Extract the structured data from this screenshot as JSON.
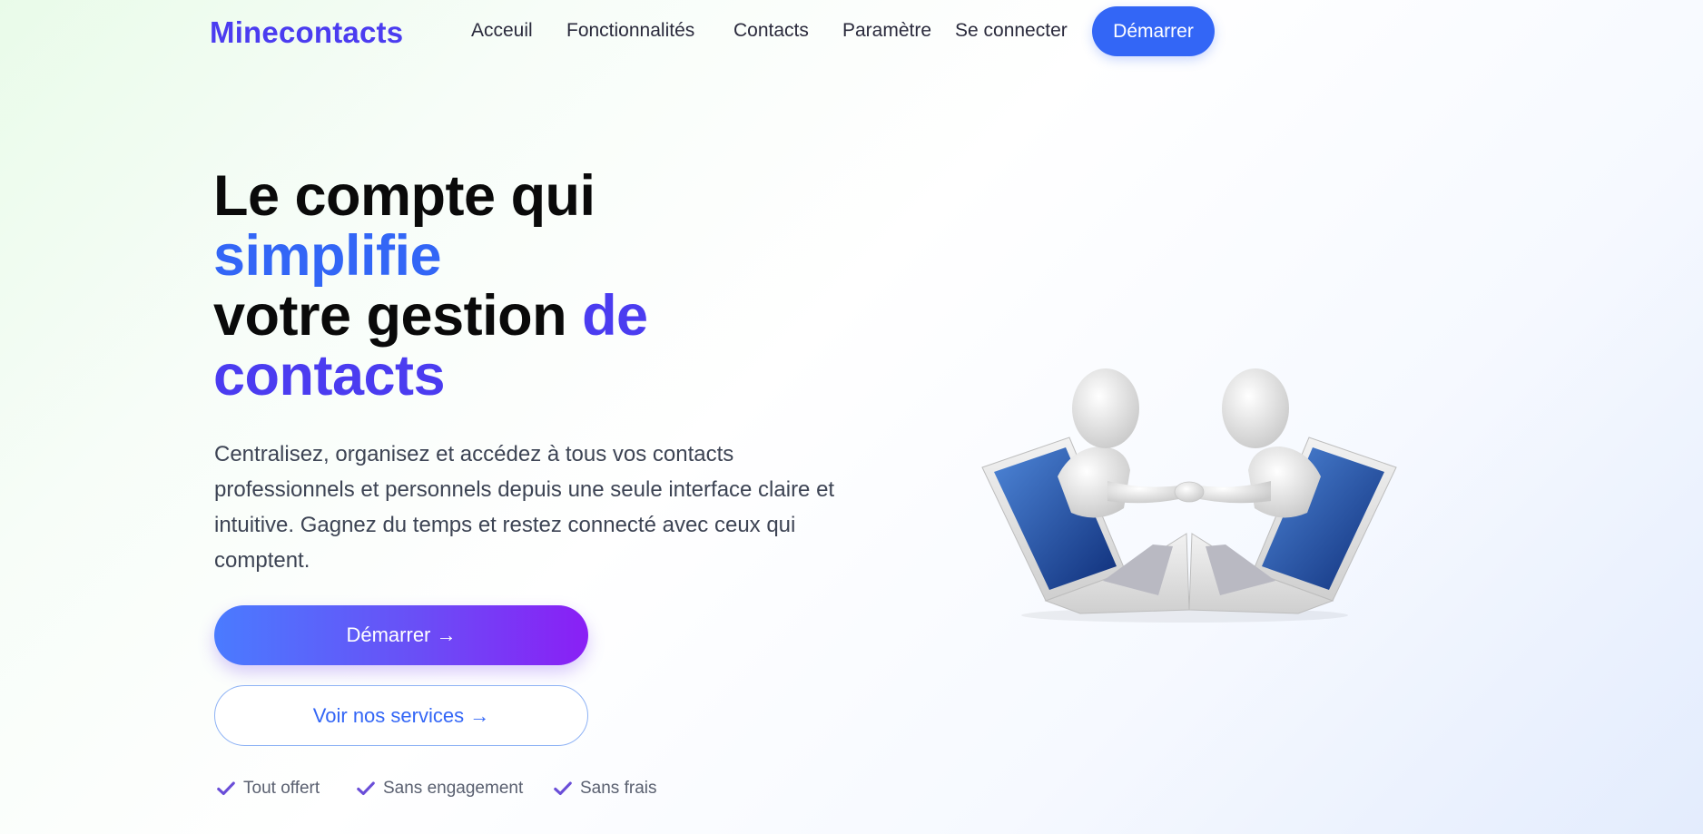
{
  "brand": {
    "name": "Minecontacts",
    "color": "#4b3cf0"
  },
  "nav": {
    "items": [
      {
        "label": "Acceuil"
      },
      {
        "label": "Fonctionnalités"
      },
      {
        "label": "Contacts"
      },
      {
        "label": "Paramètre"
      },
      {
        "label": "Se connecter"
      }
    ],
    "cta_label": "Démarrer"
  },
  "hero": {
    "title_line1": "Le compte qui",
    "title_line2": "simplifie",
    "title_line3_a": "votre gestion ",
    "title_line3_b": "de",
    "title_line4": "contacts",
    "description": "Centralisez, organisez et accédez à tous vos contacts professionnels et personnels depuis une seule interface claire et intuitive. Gagnez du temps et restez connecté avec ceux qui comptent.",
    "primary_button": "Démarrer →",
    "secondary_button": "Voir nos services →",
    "perks": [
      {
        "label": "Tout offert",
        "icon": "check-icon"
      },
      {
        "label": "Sans engagement",
        "icon": "check-icon"
      },
      {
        "label": "Sans frais",
        "icon": "check-icon"
      }
    ],
    "illustration": "handshake-laptops-illustration"
  },
  "colors": {
    "accent_blue": "#3366f6",
    "accent_violet": "#4b3cf0",
    "gradient_end": "#8a1ff5",
    "check": "#6a4ed8"
  }
}
